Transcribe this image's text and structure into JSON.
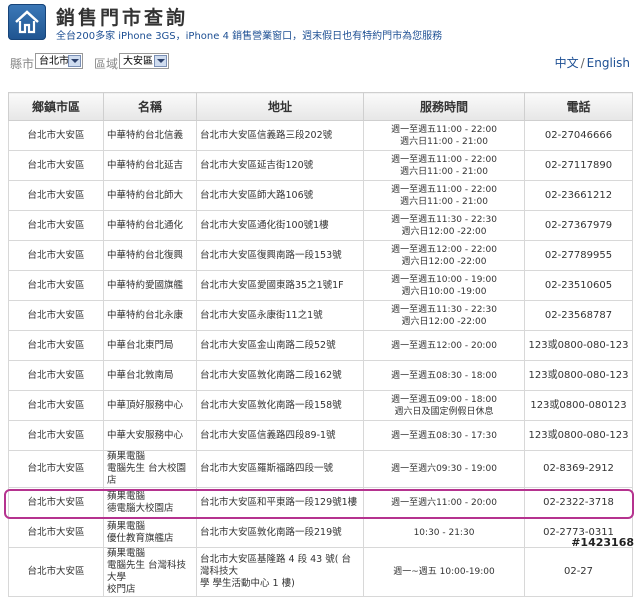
{
  "header": {
    "title": "銷售門市查詢",
    "subtitle": "全台200多家 iPhone 3GS，iPhone 4 銷售營業窗口，週末假日也有特約門市為您服務"
  },
  "filters": {
    "city_label": "縣市",
    "city_value": "台北市",
    "district_label": "區域",
    "district_value": "大安區"
  },
  "lang": {
    "zh": "中文",
    "sep": "/",
    "en": "English"
  },
  "table": {
    "headers": [
      "鄉鎮市區",
      "名稱",
      "地址",
      "服務時間",
      "電話"
    ],
    "rows": [
      {
        "district": "台北市大安區",
        "name": "中華特約台北信義",
        "address": "台北市大安區信義路三段202號",
        "hours": "週一至週五11:00 - 22:00\n週六日11:00 - 21:00",
        "phone": "02-27046666"
      },
      {
        "district": "台北市大安區",
        "name": "中華特約台北延吉",
        "address": "台北市大安區延吉街120號",
        "hours": "週一至週五11:00 - 22:00\n週六日11:00 - 21:00",
        "phone": "02-27117890"
      },
      {
        "district": "台北市大安區",
        "name": "中華特約台北師大",
        "address": "台北市大安區師大路106號",
        "hours": "週一至週五11:00 - 22:00\n週六日11:00 - 21:00",
        "phone": "02-23661212"
      },
      {
        "district": "台北市大安區",
        "name": "中華特約台北通化",
        "address": "台北市大安區通化街100號1樓",
        "hours": "週一至週五11:30 - 22:30\n週六日12:00 -22:00",
        "phone": "02-27367979"
      },
      {
        "district": "台北市大安區",
        "name": "中華特約台北復興",
        "address": "台北市大安區復興南路一段153號",
        "hours": "週一至週五12:00 - 22:00\n週六日12:00 -22:00",
        "phone": "02-27789955"
      },
      {
        "district": "台北市大安區",
        "name": "中華特約愛國旗艦",
        "address": "台北市大安區愛國東路35之1號1F",
        "hours": "週一至週五10:00 - 19:00\n週六日10:00 -19:00",
        "phone": "02-23510605"
      },
      {
        "district": "台北市大安區",
        "name": "中華特約台北永康",
        "address": "台北市大安區永康街11之1號",
        "hours": "週一至週五11:30 - 22:30\n週六日12:00 -22:00",
        "phone": "02-23568787"
      },
      {
        "district": "台北市大安區",
        "name": "中華台北東門局",
        "address": "台北市大安區金山南路二段52號",
        "hours": "週一至週五12:00 - 20:00",
        "phone": "123或0800-080-123"
      },
      {
        "district": "台北市大安區",
        "name": "中華台北敦南局",
        "address": "台北市大安區敦化南路二段162號",
        "hours": "週一至週五08:30 - 18:00",
        "phone": "123或0800-080-123"
      },
      {
        "district": "台北市大安區",
        "name": "中華頂好服務中心",
        "address": "台北市大安區敦化南路一段158號",
        "hours": "週一至週五09:00 - 18:00\n週六日及國定例假日休息",
        "phone": "123或0800-080123"
      },
      {
        "district": "台北市大安區",
        "name": "中華大安服務中心",
        "address": "台北市大安區信義路四段89-1號",
        "hours": "週一至週五08:30 - 17:30",
        "phone": "123或0800-080-123"
      },
      {
        "district": "台北市大安區",
        "name": "蘋果電腦\n電腦先生 台大校園店",
        "address": "台北市大安區羅斯福路四段一號",
        "hours": "週一至週六09:30 - 19:00",
        "phone": "02-8369-2912"
      },
      {
        "district": "台北市大安區",
        "name": "蘋果電腦\n德電腦大校園店",
        "address": "台北市大安區和平東路一段129號1樓",
        "hours": "週一至週六11:00 - 20:00",
        "phone": "02-2322-3718"
      },
      {
        "district": "台北市大安區",
        "name": "蘋果電腦\n優仕教育旗艦店",
        "address": "台北市大安區敦化南路一段219號",
        "hours": "10:30 - 21:30",
        "phone": "02-2773-0311"
      },
      {
        "district": "台北市大安區",
        "name": "蘋果電腦\n電腦先生 台灣科技大學\n校門店",
        "address": "台北市大安區基隆路 4 段 43 號( 台灣科技大\n學 學生活動中心 1 樓)",
        "hours": "週一~週五 10:00-19:00",
        "phone": "02-27"
      }
    ]
  },
  "watermark": "#1423168"
}
